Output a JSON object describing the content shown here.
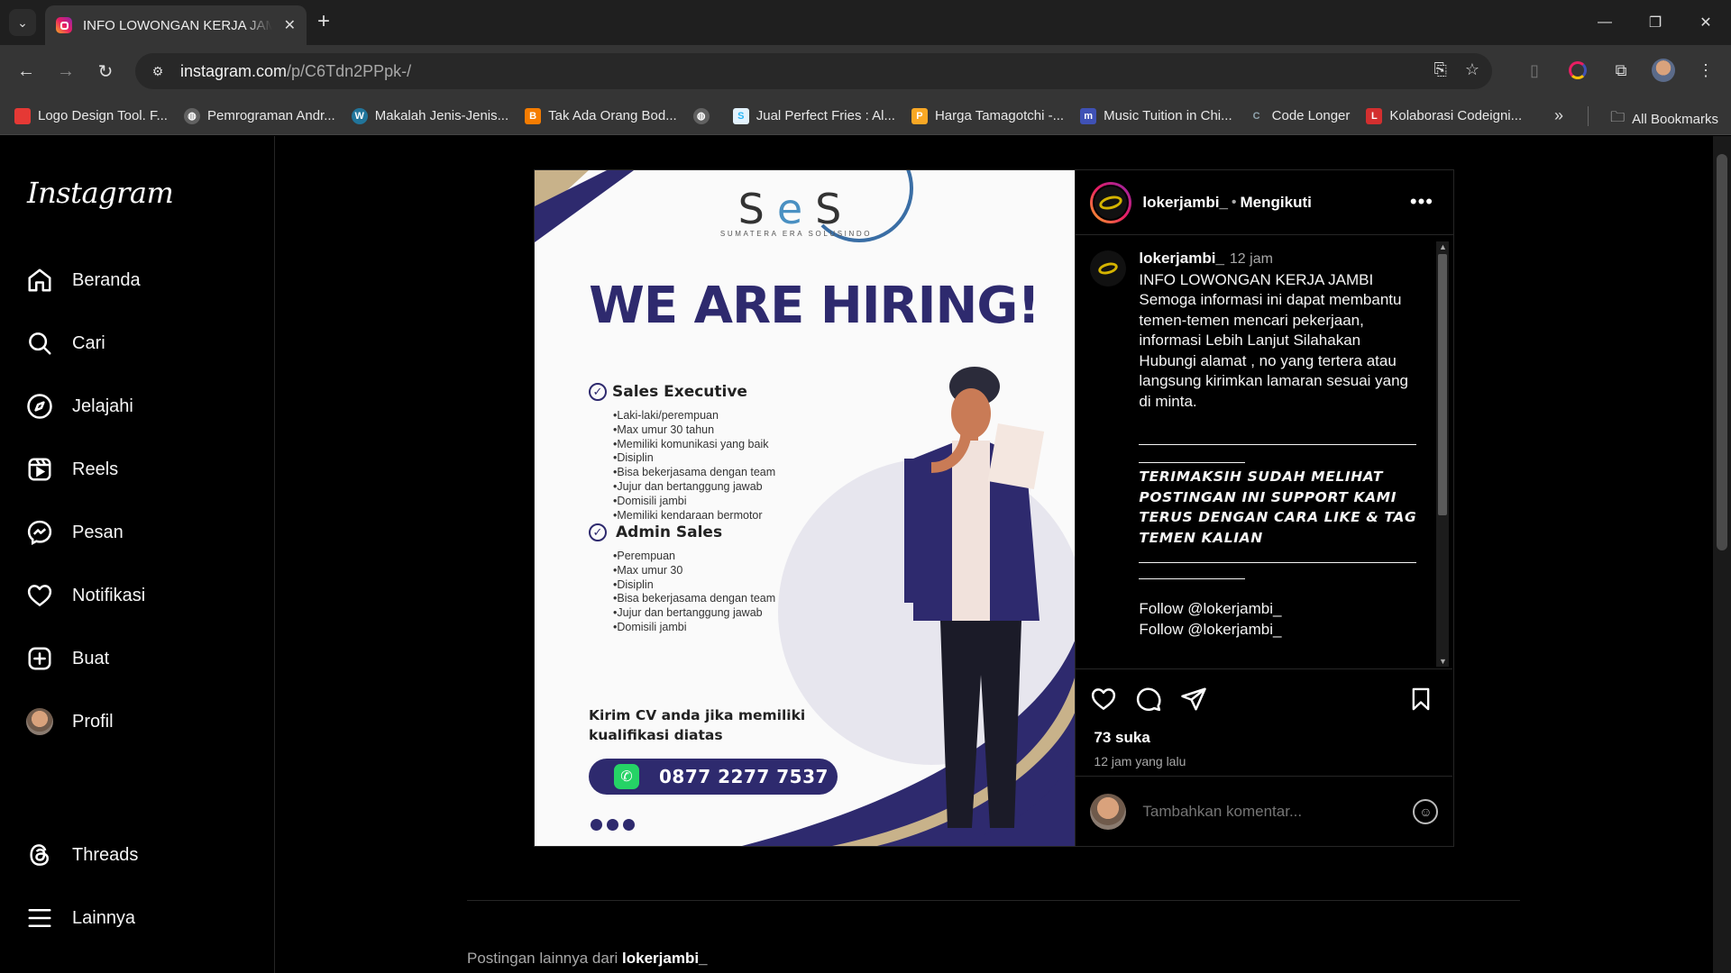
{
  "browser": {
    "tab_title": "INFO LOWONGAN KERJA JAMBI",
    "url_host": "instagram.com",
    "url_path": "/p/C6Tdn2PPpk-/",
    "bookmarks": [
      {
        "label": "Logo Design Tool. F...",
        "icon": "logo-design-icon",
        "color": "#e53935"
      },
      {
        "label": "Pemrograman Andr...",
        "icon": "globe-icon",
        "color": "#616161"
      },
      {
        "label": "Makalah Jenis-Jenis...",
        "icon": "wordpress-icon",
        "color": "#21759b"
      },
      {
        "label": "Tak Ada Orang Bod...",
        "icon": "blogger-icon",
        "color": "#f57c00"
      },
      {
        "label": "",
        "icon": "globe-icon",
        "color": "#616161"
      },
      {
        "label": "Jual Perfect Fries : Al...",
        "icon": "s-icon",
        "color": "#29b6f6"
      },
      {
        "label": "Harga Tamagotchi -...",
        "icon": "p-icon",
        "color": "#f9a825"
      },
      {
        "label": "Music Tuition in Chi...",
        "icon": "music-icon",
        "color": "#3f51b5"
      },
      {
        "label": "Code Longer",
        "icon": "c-icon",
        "color": "#90a4ae"
      },
      {
        "label": "Kolaborasi Codeigni...",
        "icon": "codeigniter-icon",
        "color": "#d32f2f"
      }
    ],
    "all_bookmarks": "All Bookmarks"
  },
  "sidebar": {
    "logo": "Instagram",
    "items": [
      {
        "label": "Beranda"
      },
      {
        "label": "Cari"
      },
      {
        "label": "Jelajahi"
      },
      {
        "label": "Reels"
      },
      {
        "label": "Pesan"
      },
      {
        "label": "Notifikasi"
      },
      {
        "label": "Buat"
      },
      {
        "label": "Profil"
      },
      {
        "label": "Threads"
      },
      {
        "label": "Lainnya"
      }
    ]
  },
  "post": {
    "username": "lokerjambi_",
    "separator": "•",
    "follow_status": "Mengikuti",
    "time": "12 jam",
    "caption": "INFO LOWONGAN KERJA JAMBI\nSemoga informasi ini dapat membantu temen-temen mencari pekerjaan, informasi Lebih Lanjut Silahakan Hubungi alamat , no yang tertera atau langsung kirimkan lamaran sesuai yang di minta.",
    "caption_bold": "TERIMAKSIH SUDAH MELIHAT POSTINGAN INI SUPPORT KAMI TERUS DENGAN CARA LIKE & TAG TEMEN KALIAN",
    "follow_line_1": "Follow @lokerjambi_",
    "follow_line_2": "Follow @lokerjambi_",
    "likes": "73 suka",
    "posted_ago": "12 jam yang lalu",
    "comment_placeholder": "Tambahkan komentar..."
  },
  "poster": {
    "logo_letters": "SeS",
    "logo_sub": "SUMATERA ERA SOLUSINDO",
    "headline": "WE ARE HIRING!",
    "job1_title": "Sales Executive",
    "job1_reqs": [
      "•Laki-laki/perempuan",
      "•Max umur 30 tahun",
      "•Memiliki komunikasi yang baik",
      "•Disiplin",
      "•Bisa bekerjasama dengan team",
      "•Jujur dan bertanggung jawab",
      "•Domisili jambi",
      "•Memiliki kendaraan bermotor"
    ],
    "job2_title": "Admin Sales",
    "job2_reqs": [
      "•Perempuan",
      "•Max umur 30",
      "•Disiplin",
      "•Bisa bekerjasama dengan team",
      "•Jujur dan bertanggung jawab",
      "•Domisili jambi"
    ],
    "cv_text": "Kirim CV anda jika memiliki kualifikasi diatas",
    "phone": "0877 2277 7537"
  },
  "more_posts": {
    "prefix": "Postingan lainnya dari",
    "user": "lokerjambi_"
  }
}
